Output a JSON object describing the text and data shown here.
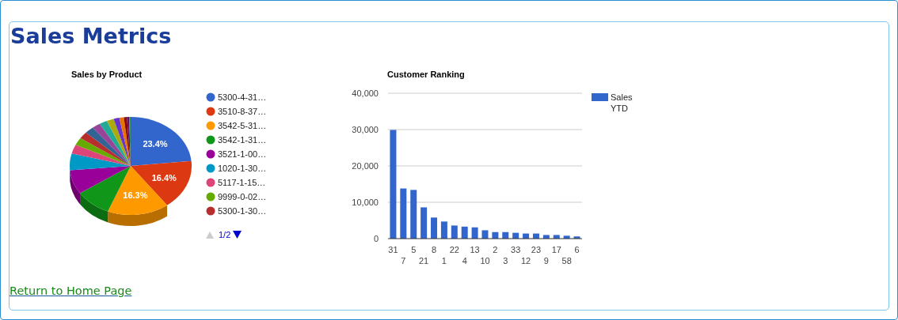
{
  "page": {
    "title": "Sales Metrics"
  },
  "pie_chart": {
    "title": "Sales by Product",
    "legend": [
      {
        "label": "5300-4-31…",
        "color": "#3366cc"
      },
      {
        "label": "3510-8-37…",
        "color": "#dc3912"
      },
      {
        "label": "3542-5-31…",
        "color": "#ff9900"
      },
      {
        "label": "3542-1-31…",
        "color": "#109618"
      },
      {
        "label": "3521-1-00…",
        "color": "#990099"
      },
      {
        "label": "1020-1-30…",
        "color": "#0099c6"
      },
      {
        "label": "5117-1-15…",
        "color": "#dd4477"
      },
      {
        "label": "9999-0-02…",
        "color": "#66aa00"
      },
      {
        "label": "5300-1-30…",
        "color": "#b82e2e"
      }
    ],
    "slice_labels": [
      "23.4%",
      "16.4%",
      "16.3%"
    ],
    "pager": {
      "text": "1/2",
      "prev_disabled": true,
      "next_disabled": false
    }
  },
  "bar_chart": {
    "chart_data": {
      "type": "bar",
      "title": "Customer Ranking",
      "categories": [
        "31",
        "7",
        "5",
        "21",
        "8",
        "1",
        "22",
        "4",
        "13",
        "10",
        "2",
        "3",
        "33",
        "12",
        "23",
        "9",
        "17",
        "58",
        "6"
      ],
      "series": [
        {
          "name": "Sales YTD",
          "color": "#3366cc",
          "values": [
            29900,
            13800,
            13400,
            8600,
            5800,
            4700,
            3600,
            3300,
            3100,
            2300,
            1800,
            1800,
            1600,
            1400,
            1400,
            1000,
            1000,
            800,
            600
          ]
        }
      ],
      "ylim": [
        0,
        40000
      ],
      "grid": true,
      "yticks": [
        {
          "value": 0,
          "label": "0"
        },
        {
          "value": 10000,
          "label": "10,000"
        },
        {
          "value": 20000,
          "label": "20,000"
        },
        {
          "value": 30000,
          "label": "30,000"
        },
        {
          "value": 40000,
          "label": "40,000"
        }
      ]
    },
    "kind": "chart"
  },
  "link": {
    "text": "Return to Home Page"
  }
}
